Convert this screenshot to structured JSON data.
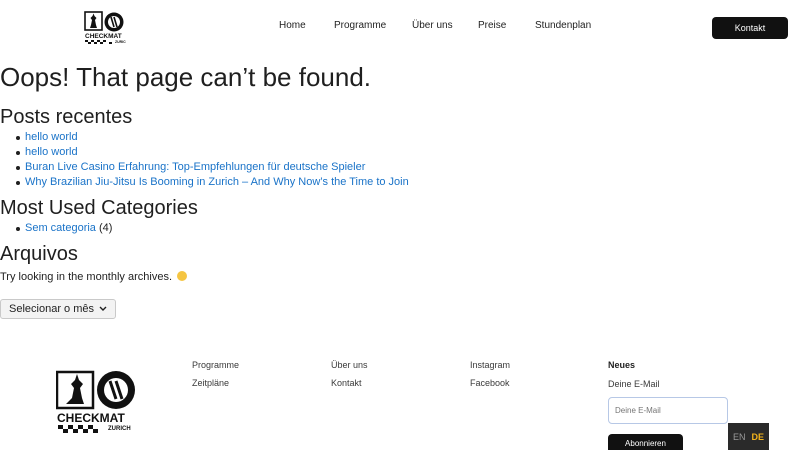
{
  "header": {
    "logo_alt": "CHECKMAT ZURICH",
    "nav": [
      "Home",
      "Programme",
      "Über uns",
      "Preise",
      "Stundenplan"
    ],
    "contact_label": "Kontakt"
  },
  "main": {
    "title": "Oops! That page can’t be found.",
    "recent_heading": "Posts recentes",
    "recent_posts": [
      "hello world",
      "hello world",
      "Buran Live Casino Erfahrung: Top-Empfehlungen für deutsche Spieler",
      "Why Brazilian Jiu-Jitsu Is Booming in Zurich – And Why Now’s the Time to Join"
    ],
    "categories_heading": "Most Used Categories",
    "categories": [
      {
        "name": "Sem categoria",
        "count": "(4)"
      }
    ],
    "archives_heading": "Arquivos",
    "archives_text": "Try looking in the monthly archives.",
    "month_select": "Selecionar o mês"
  },
  "footer": {
    "logo_text": "CHECKMAT",
    "logo_sub": "ZURICH",
    "col1": [
      "Programme",
      "Zeitpläne"
    ],
    "col2": [
      "Über uns",
      "Kontakt"
    ],
    "col3": [
      "Instagram",
      "Facebook"
    ],
    "newsletter_title": "Neues",
    "newsletter_label": "Deine E-Mail",
    "newsletter_placeholder": "Deine E-Mail",
    "subscribe_label": "Abonnieren"
  },
  "lang": {
    "en": "EN",
    "de": "DE"
  },
  "colors": {
    "link": "#1a73c8",
    "button": "#111111",
    "lang_active": "#f2b31c"
  }
}
